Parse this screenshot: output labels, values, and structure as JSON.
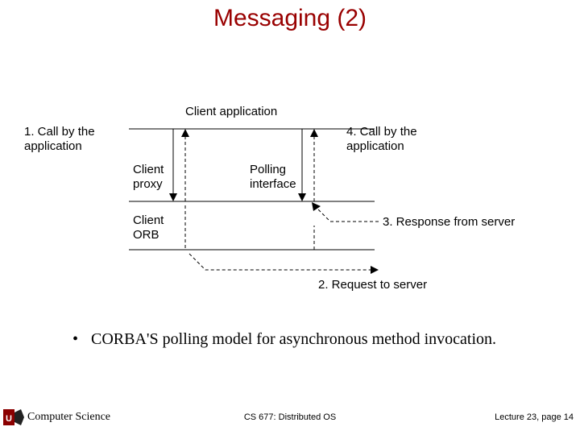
{
  "title": "Messaging (2)",
  "diagram": {
    "client_application": "Client application",
    "call1": "1. Call by the\napplication",
    "call4": "4. Call by the\napplication",
    "client_proxy": "Client\nproxy",
    "polling_interface": "Polling\ninterface",
    "response3": "3. Response from server",
    "client_orb": "Client\nORB",
    "request2": "2. Request to server"
  },
  "bullet": "CORBA'S polling model for asynchronous method invocation.",
  "footer": {
    "left": "Computer Science",
    "center": "CS 677: Distributed OS",
    "right": "Lecture 23, page 14"
  }
}
